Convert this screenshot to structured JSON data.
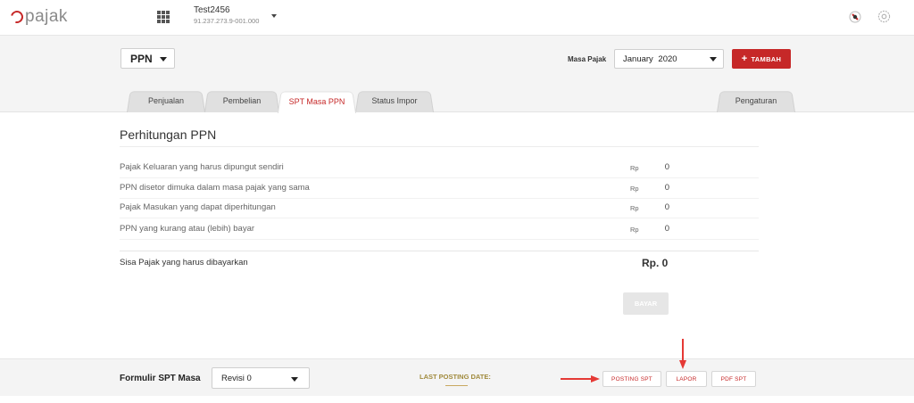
{
  "header": {
    "logo_text": "pajak",
    "company_name": "Test2456",
    "company_npwp": "91.237.273.9-001.000",
    "icons": [
      "apps-grid-icon",
      "notification-icon",
      "settings-gear-icon"
    ]
  },
  "toolbar": {
    "tax_type": "PPN",
    "masa_pajak_label": "Masa Pajak",
    "masa_pajak_value": "January  2020",
    "tambah_label": "TAMBAH"
  },
  "tabs": [
    {
      "label": "Penjualan",
      "active": false
    },
    {
      "label": "Pembelian",
      "active": false
    },
    {
      "label": "SPT Masa PPN",
      "active": true
    },
    {
      "label": "Status Impor",
      "active": false
    },
    {
      "label": "Pengaturan",
      "active": false
    }
  ],
  "content": {
    "title": "Perhitungan PPN",
    "rows": [
      {
        "desc": "Pajak Keluaran yang harus dipungut sendiri",
        "currency": "Rp",
        "value": "0"
      },
      {
        "desc": "PPN disetor dimuka dalam masa pajak yang sama",
        "currency": "Rp",
        "value": "0"
      },
      {
        "desc": "Pajak Masukan yang dapat diperhitungan",
        "currency": "Rp",
        "value": "0"
      },
      {
        "desc": "PPN yang kurang atau (lebih) bayar",
        "currency": "Rp",
        "value": "0"
      }
    ],
    "sisa_label": "Sisa Pajak yang harus dibayarkan",
    "sisa_value": "Rp. 0",
    "bayar_label": "BAYAR"
  },
  "footer": {
    "form_label": "Formulir SPT Masa",
    "revisi_value": "Revisi 0",
    "last_posting_label": "LAST POSTING DATE:",
    "posting_label": "POSTING SPT",
    "lapor_label": "LAPOR",
    "pdf_label": "PDF SPT"
  },
  "colors": {
    "accent": "#c62828",
    "header_bg": "#f4f4f4",
    "arrow": "#e53935"
  }
}
